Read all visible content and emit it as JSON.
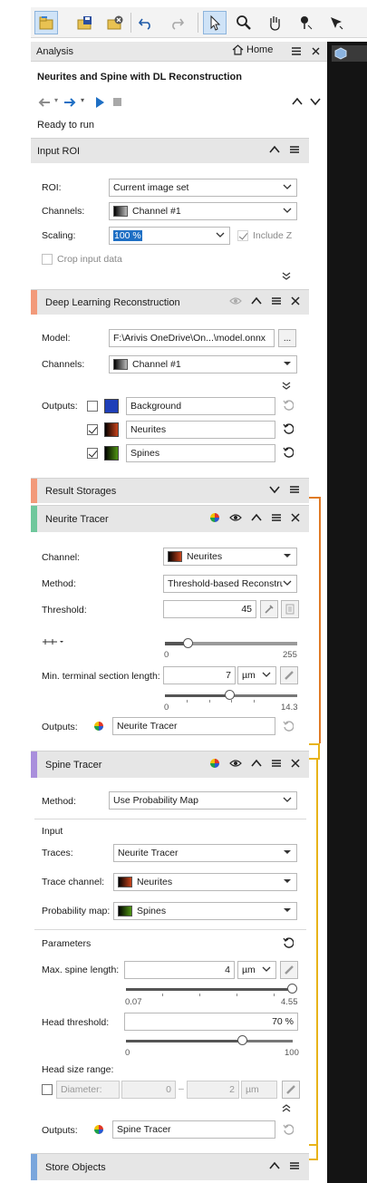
{
  "colors": {
    "accent_blue": "#1e6fc4",
    "marker_orange": "#f29a7a",
    "marker_green": "#6fc79c",
    "marker_purple": "#a98fdc",
    "marker_blue": "#7aa6dc",
    "link_orange": "#e07b26"
  },
  "toolbar": {
    "icons": [
      "new-pipeline-icon",
      "save-pipeline-icon",
      "close-pipeline-icon",
      "undo-icon",
      "redo-icon",
      "select-pointer-icon",
      "zoom-icon",
      "pan-hand-icon",
      "pin-tool-icon",
      "arrow-tool-icon"
    ]
  },
  "analysis": {
    "title": "Analysis",
    "home_label": "Home",
    "pipeline_name": "Neurites and Spine with DL Reconstruction",
    "status": "Ready to run"
  },
  "input_roi": {
    "title": "Input ROI",
    "roi_label": "ROI:",
    "roi_value": "Current image set",
    "channels_label": "Channels:",
    "channels_value": "Channel #1",
    "scaling_label": "Scaling:",
    "scaling_value": "100 %",
    "include_z_label": "Include Z",
    "crop_label": "Crop input data"
  },
  "dl_recon": {
    "title": "Deep Learning Reconstruction",
    "model_label": "Model:",
    "model_value": "F:\\Arivis OneDrive\\On...\\model.onnx",
    "browse_label": "...",
    "channels_label": "Channels:",
    "channels_value": "Channel #1",
    "outputs_label": "Outputs:",
    "outputs": [
      {
        "name": "Background",
        "checked": false,
        "color": "#1f3fb8"
      },
      {
        "name": "Neurites",
        "checked": true,
        "color": "#b5340f"
      },
      {
        "name": "Spines",
        "checked": true,
        "color": "#3f7d0e"
      }
    ]
  },
  "result_storages": {
    "title": "Result Storages"
  },
  "neurite_tracer": {
    "title": "Neurite Tracer",
    "channel_label": "Channel:",
    "channel_value": "Neurites",
    "method_label": "Method:",
    "method_value": "Threshold-based Reconstru",
    "threshold_label": "Threshold:",
    "threshold_value": "45",
    "threshold_min": "0",
    "threshold_max": "255",
    "threshold_level": 0.176,
    "min_terminal_label": "Min. terminal section length:",
    "min_terminal_value": "7",
    "min_terminal_unit": "µm",
    "min_terminal_min": "0",
    "min_terminal_max": "14.3",
    "min_terminal_level": 0.49,
    "outputs_label": "Outputs:",
    "output_value": "Neurite Tracer"
  },
  "spine_tracer": {
    "title": "Spine Tracer",
    "method_label": "Method:",
    "method_value": "Use Probability Map",
    "input_heading": "Input",
    "traces_label": "Traces:",
    "traces_value": "Neurite Tracer",
    "trace_channel_label": "Trace channel:",
    "trace_channel_value": "Neurites",
    "prob_map_label": "Probability map:",
    "prob_map_value": "Spines",
    "parameters_heading": "Parameters",
    "max_spine_label": "Max. spine length:",
    "max_spine_value": "4",
    "max_spine_unit": "µm",
    "max_spine_min": "0.07",
    "max_spine_max": "4.55",
    "max_spine_level": 1.0,
    "head_threshold_label": "Head threshold:",
    "head_threshold_value": "70 %",
    "head_threshold_min": "0",
    "head_threshold_max": "100",
    "head_threshold_level": 0.7,
    "head_size_label": "Head size range:",
    "diameter_label": "Diameter:",
    "range_from": "0",
    "range_sep": "–",
    "range_to": "2",
    "range_unit": "µm",
    "outputs_label": "Outputs:",
    "output_value": "Spine Tracer"
  },
  "store_objects": {
    "title": "Store Objects"
  }
}
